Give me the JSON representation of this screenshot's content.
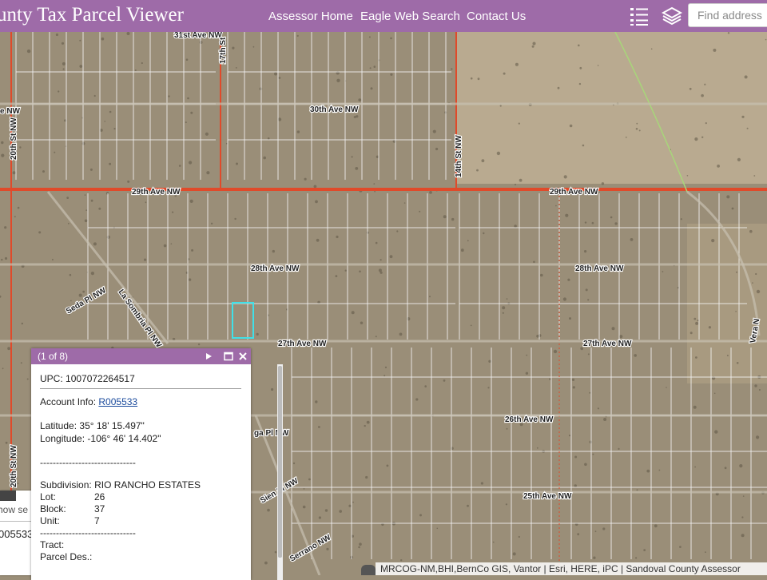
{
  "header": {
    "title": "unty Tax Parcel Viewer",
    "nav": [
      "Assessor Home",
      "Eagle Web Search",
      "Contact Us"
    ],
    "search_placeholder": "Find address",
    "list_icon": "list-icon",
    "layers_icon": "layers-icon"
  },
  "map": {
    "roads": [
      "31st Ave NW",
      "30th Ave NW",
      "29th Ave NW",
      "29th Ave NW",
      "28th Ave NW",
      "28th Ave NW",
      "27th Ave NW",
      "27th Ave NW",
      "26th Ave NW",
      "25th Ave NW",
      "17th St",
      "14th St NW",
      "20th St NW",
      "20th St NW",
      "Seda Pl NW",
      "La Sombria Pl NW",
      "Sien Pl NW",
      "Serrano NW",
      "ga Pl NW",
      "Vera N",
      "e NW"
    ],
    "colors": {
      "imagery": "#9a8e78",
      "parcel_line": "#f2f2f2",
      "road_line": "#e04a2a",
      "selected": "#40e0e8",
      "trail": "#a8d67a"
    }
  },
  "popup": {
    "title": "(1 of 8)",
    "upc_label": "UPC:",
    "upc_value": "1007072264517",
    "account_label": "Account Info:",
    "account_value": "R005533",
    "latitude_label": "Latitude:",
    "latitude_value": "35° 18' 15.497\"",
    "longitude_label": "Longitude:",
    "longitude_value": "-106° 46' 14.402\"",
    "separator": "------------------------------",
    "subdivision_label": "Subdivision:",
    "subdivision_value": "RIO RANCHO ESTATES",
    "lot_label": "Lot:",
    "lot_value": "26",
    "block_label": "Block:",
    "block_value": "37",
    "unit_label": "Unit:",
    "unit_value": "7",
    "tract_label": "Tract:",
    "parcel_des_label": "Parcel Des.:",
    "icons": [
      "next-icon",
      "maximize-icon",
      "close-icon"
    ]
  },
  "side_panel": {
    "label": "how se",
    "value": "005533"
  },
  "attribution": "MRCOG-NM,BHI,BernCo GIS, Vantor | Esri, HERE, iPC | Sandoval County Assessor"
}
